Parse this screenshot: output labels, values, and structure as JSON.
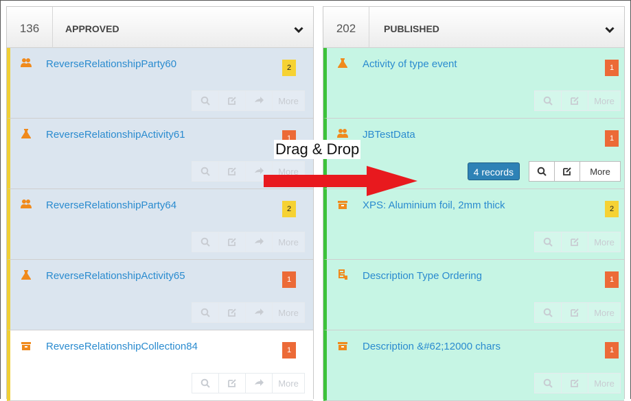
{
  "columns": [
    {
      "count": "136",
      "title": "APPROVED",
      "cards": [
        {
          "icon": "party-icon",
          "title": "ReverseRelationshipParty60",
          "badge": "2",
          "badge_color": "#f6d233"
        },
        {
          "icon": "activity-icon",
          "title": "ReverseRelationshipActivity61",
          "badge": "1",
          "badge_color": "#ec6a37"
        },
        {
          "icon": "party-icon",
          "title": "ReverseRelationshipParty64",
          "badge": "2",
          "badge_color": "#f6d233"
        },
        {
          "icon": "activity-icon",
          "title": "ReverseRelationshipActivity65",
          "badge": "1",
          "badge_color": "#ec6a37"
        },
        {
          "icon": "collection-icon",
          "title": "ReverseRelationshipCollection84",
          "badge": "1",
          "badge_color": "#ec6a37"
        }
      ]
    },
    {
      "count": "202",
      "title": "PUBLISHED",
      "cards": [
        {
          "icon": "activity-icon",
          "title": "Activity of type event",
          "badge": "1",
          "badge_color": "#ec6a37"
        },
        {
          "icon": "party-icon",
          "title": "JBTestData",
          "badge": "1",
          "badge_color": "#ec6a37"
        },
        {
          "icon": "collection-icon",
          "title": "XPS: Aluminium foil, 2mm thick",
          "badge": "2",
          "badge_color": "#f6d233"
        },
        {
          "icon": "service-icon",
          "title": "Description Type Ordering",
          "badge": "1",
          "badge_color": "#ec6a37"
        },
        {
          "icon": "collection-icon",
          "title": "Description &#62;12000 chars",
          "badge": "1",
          "badge_color": "#ec6a37"
        }
      ]
    }
  ],
  "actions": {
    "more_label": "More"
  },
  "drag": {
    "label": "Drag & Drop",
    "records_label": "4 records"
  },
  "colors": {
    "approved_accent": "#f0cf35",
    "published_accent": "#3cc23a",
    "link": "#2a8bcf",
    "arrow": "#e8191e"
  }
}
